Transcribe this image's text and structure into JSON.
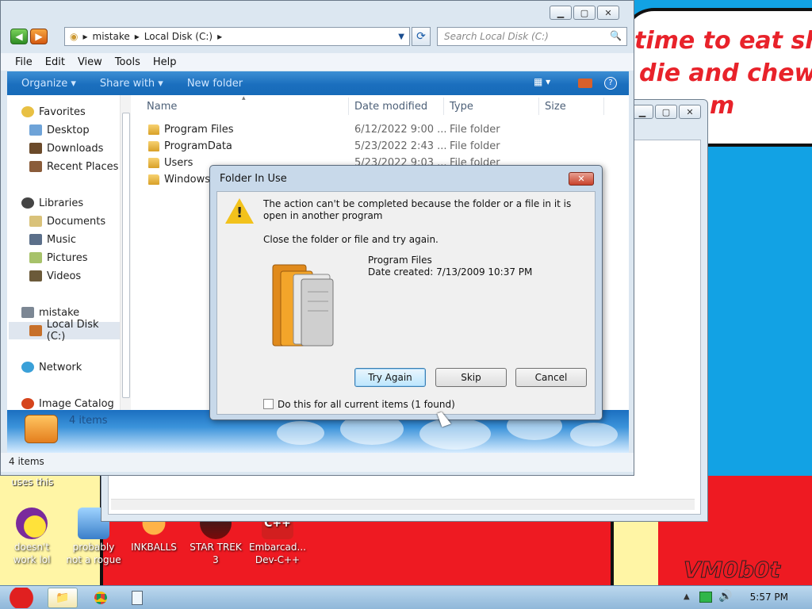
{
  "wallpaper": {
    "bubble_line1": "time to eat shit",
    "bubble_line2": "die and chew",
    "bubble_line3": "m",
    "note": "uses this",
    "signature": "VM0b0t"
  },
  "desktop_icons": [
    {
      "label": "doesn't work lol"
    },
    {
      "label": "probably not a rogue"
    },
    {
      "label": "INKBALLS"
    },
    {
      "label": "STAR TREK 3"
    },
    {
      "label": "Embarcad... Dev-C++"
    }
  ],
  "explorer": {
    "address": {
      "segments": [
        "mistake",
        "Local Disk (C:)"
      ]
    },
    "search_placeholder": "Search Local Disk (C:)",
    "menu": [
      "File",
      "Edit",
      "View",
      "Tools",
      "Help"
    ],
    "commands": {
      "organize": "Organize",
      "share": "Share with",
      "new_folder": "New folder"
    },
    "nav": {
      "favorites": "Favorites",
      "desktop": "Desktop",
      "downloads": "Downloads",
      "recent": "Recent Places",
      "libraries": "Libraries",
      "documents": "Documents",
      "music": "Music",
      "pictures": "Pictures",
      "videos": "Videos",
      "computer": "mistake",
      "local_disk": "Local Disk (C:)",
      "network": "Network",
      "image_catalog": "Image Catalog"
    },
    "columns": {
      "name": "Name",
      "date": "Date modified",
      "type": "Type",
      "size": "Size"
    },
    "files": [
      {
        "name": "Program Files",
        "date": "6/12/2022 9:00 ...",
        "type": "File folder"
      },
      {
        "name": "ProgramData",
        "date": "5/23/2022 2:43 ...",
        "type": "File folder"
      },
      {
        "name": "Users",
        "date": "5/23/2022 9:03 ...",
        "type": "File folder"
      },
      {
        "name": "Windows",
        "date": "",
        "type": ""
      }
    ],
    "details_count": "4 items",
    "status": "4 items"
  },
  "dialog": {
    "title": "Folder In Use",
    "message": "The action can't be completed because the folder or a file in it is open in another program",
    "hint": "Close the folder or file and try again.",
    "item_name": "Program Files",
    "item_date": "Date created: 7/13/2009 10:37 PM",
    "buttons": {
      "try_again": "Try Again",
      "skip": "Skip",
      "cancel": "Cancel"
    },
    "checkbox_label": "Do this for all current items (1 found)"
  },
  "taskbar": {
    "clock": "5:57 PM"
  },
  "colors": {
    "accent": "#1b6fbe",
    "wallpaper_blue": "#12a2e4",
    "wallpaper_red": "#ee1a22"
  }
}
